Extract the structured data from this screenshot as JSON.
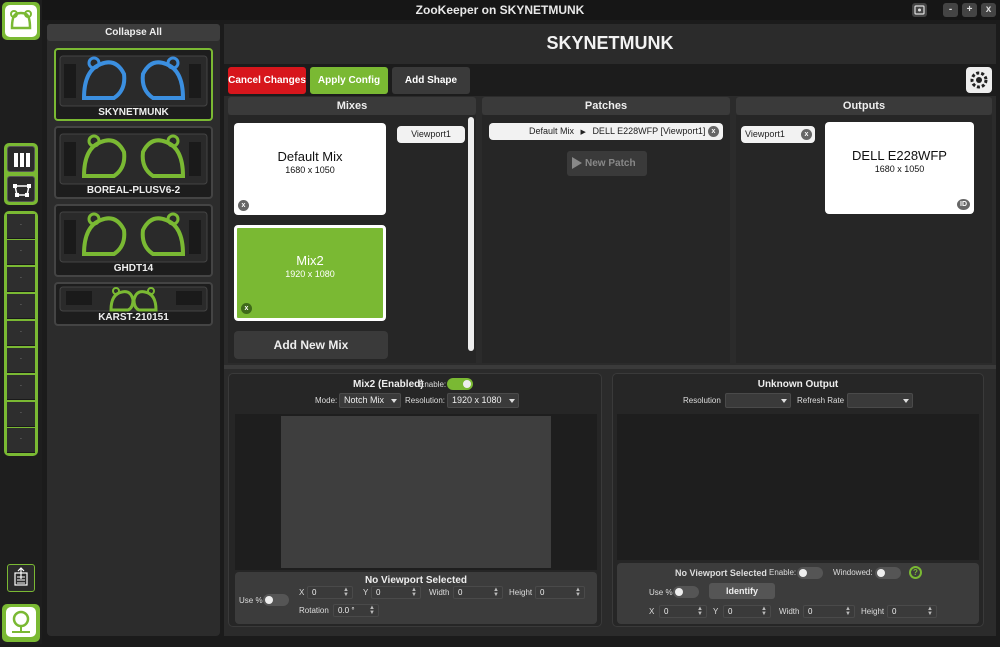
{
  "window": {
    "title": "ZooKeeper on SKYNETMUNK",
    "buttons": [
      "-",
      "+",
      "x"
    ]
  },
  "rail": {
    "slot_marker": "·"
  },
  "devices": {
    "collapse_label": "Collapse All",
    "items": [
      {
        "name": "SKYNETMUNK",
        "selected": true
      },
      {
        "name": "BOREAL-PLUSV6-2",
        "selected": false
      },
      {
        "name": "GHDT14",
        "selected": false
      },
      {
        "name": "KARST-210151",
        "selected": false
      }
    ]
  },
  "main": {
    "heading": "SKYNETMUNK",
    "toolbar": {
      "cancel": "Cancel Changes",
      "apply": "Apply Config",
      "add_shape": "Add Shape"
    },
    "mixes": {
      "header": "Mixes",
      "items": [
        {
          "name": "Default Mix",
          "resolution": "1680 x 1050",
          "badge": "x"
        },
        {
          "name": "Mix2",
          "resolution": "1920 x 1080",
          "badge": "x"
        }
      ],
      "viewport": "Viewport1",
      "add_new": "Add New Mix"
    },
    "patches": {
      "header": "Patches",
      "patch_source": "Default Mix",
      "patch_arrow": "▶",
      "patch_target": "DELL E228WFP [Viewport1]",
      "patch_badge": "x",
      "new_patch": "New Patch"
    },
    "outputs": {
      "header": "Outputs",
      "viewport": "Viewport1",
      "viewport_badge": "x",
      "item": {
        "name": "DELL E228WFP",
        "resolution": "1680 x 1050",
        "badge": "ID"
      }
    }
  },
  "mix_editor": {
    "title": "Mix2 (Enabled)",
    "enable_label": "Enable:",
    "mode_label": "Mode:",
    "mode_value": "Notch Mix",
    "resolution_label": "Resolution:",
    "resolution_value": "1920 x 1080",
    "viewport_panel": {
      "title": "No Viewport Selected",
      "use_pct": "Use %",
      "x_label": "X",
      "x_value": "0",
      "y_label": "Y",
      "y_value": "0",
      "width_label": "Width",
      "width_value": "0",
      "height_label": "Height",
      "height_value": "0",
      "rotation_label": "Rotation",
      "rotation_value": "0.0 °"
    }
  },
  "output_editor": {
    "title": "Unknown Output",
    "resolution_label": "Resolution",
    "refresh_label": "Refresh Rate",
    "viewport_panel": {
      "title": "No Viewport Selected",
      "enable_label": "Enable:",
      "windowed_label": "Windowed:",
      "help": "?",
      "use_pct": "Use %",
      "identify": "Identify",
      "x_label": "X",
      "x_value": "0",
      "y_label": "Y",
      "y_value": "0",
      "width_label": "Width",
      "width_value": "0",
      "height_label": "Height",
      "height_value": "0"
    }
  },
  "colors": {
    "accent": "#7ab933",
    "cancel": "#d7161c",
    "panel": "#2b2b2b",
    "dark": "#1c1c1c"
  }
}
